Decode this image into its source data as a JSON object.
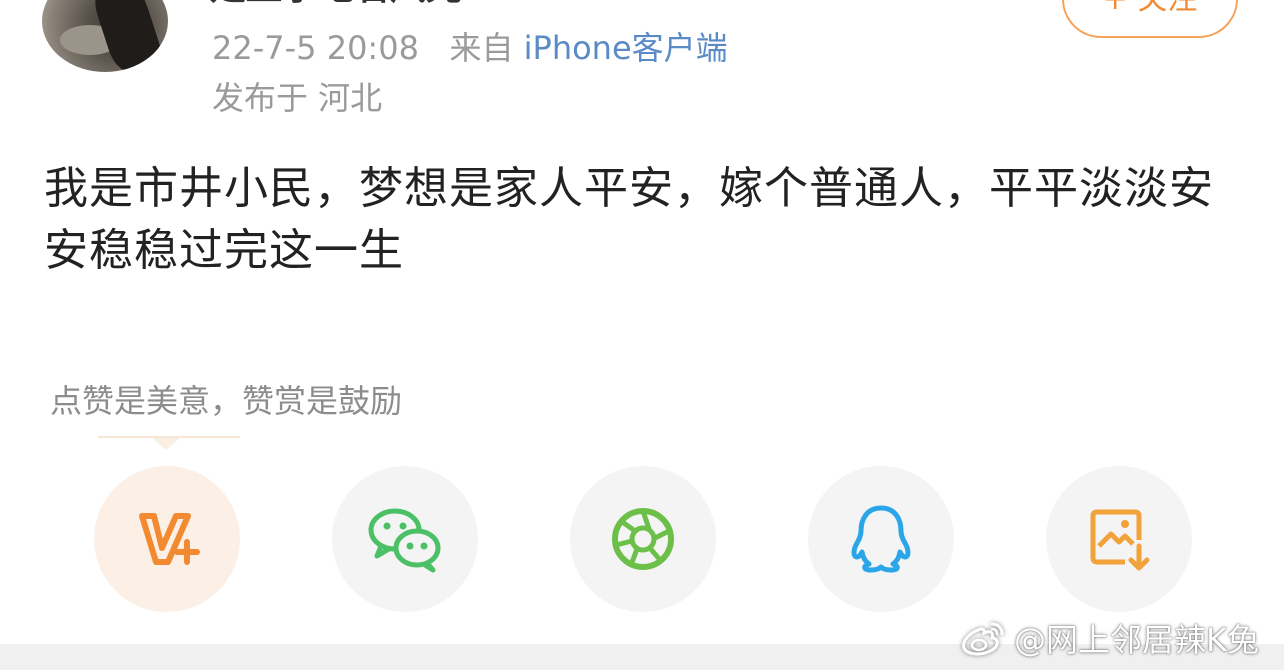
{
  "post": {
    "username": "是显示地名风光",
    "follow_label": "+ 关注",
    "date": "22-7-5 20:08",
    "source_prefix": "来自",
    "source": "iPhone客户端",
    "location": "发布于 河北",
    "text": "我是市井小民，梦想是家人平安，嫁个普通人，平平淡淡安安稳稳过完这一生"
  },
  "reward": {
    "tip": "点赞是美意，赞赏是鼓励"
  },
  "share": {
    "buttons": [
      {
        "icon": "vplus-icon",
        "color": "#f28a31"
      },
      {
        "icon": "wechat-icon",
        "color": "#4cc066"
      },
      {
        "icon": "moments-icon",
        "color": "#6cc04a"
      },
      {
        "icon": "qq-icon",
        "color": "#29a5e8"
      },
      {
        "icon": "save-image-icon",
        "color": "#f2a23a"
      }
    ]
  },
  "watermark": {
    "text": "@网上邻居辣K兔"
  }
}
